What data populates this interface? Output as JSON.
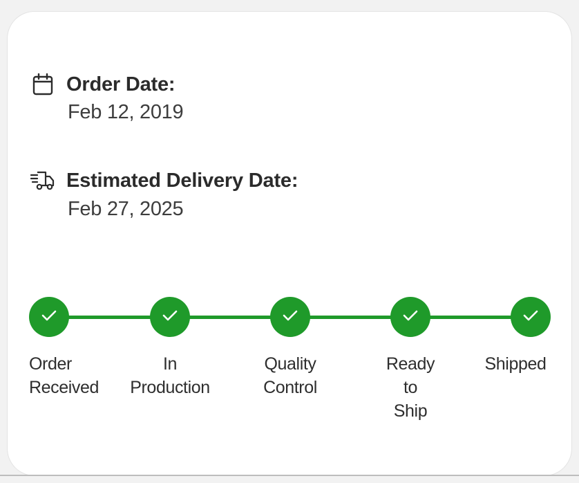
{
  "order": {
    "icon": "calendar-icon",
    "label": "Order Date:",
    "value": "Feb 12, 2019"
  },
  "delivery": {
    "icon": "delivery-truck-icon",
    "label": "Estimated Delivery Date:",
    "value": "Feb 27, 2025"
  },
  "accent_color": "#1f9a2a",
  "steps": [
    {
      "label": "Order\nReceived",
      "completed": true,
      "icon": "check-icon"
    },
    {
      "label": "In\nProduction",
      "completed": true,
      "icon": "check-icon"
    },
    {
      "label": "Quality\nControl",
      "completed": true,
      "icon": "check-icon"
    },
    {
      "label": "Ready\nto\nShip",
      "completed": true,
      "icon": "check-icon"
    },
    {
      "label": "Shipped",
      "completed": true,
      "icon": "check-icon"
    }
  ]
}
